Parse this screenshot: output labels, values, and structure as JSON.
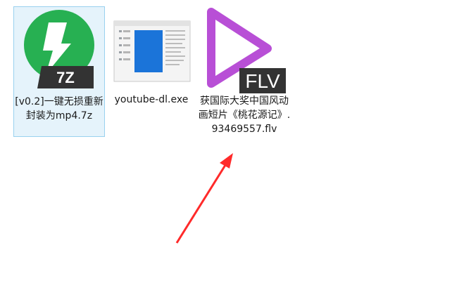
{
  "files": [
    {
      "label": "[v0.2]一键无损重新封装为mp4.7z",
      "badge": "7Z",
      "icon": "7z-archive-icon",
      "selected": true
    },
    {
      "label": "youtube-dl.exe",
      "icon": "exe-application-icon",
      "selected": false
    },
    {
      "label": "获国际大奖中国风动画短片《桃花源记》.93469557.flv",
      "badge": "FLV",
      "icon": "flv-video-icon",
      "selected": false
    }
  ],
  "annotation": {
    "icon": "red-arrow-icon",
    "color": "#ff2a2a"
  },
  "colors": {
    "selection_bg": "#e5f3fb",
    "selection_border": "#99d1ef",
    "archive_green": "#27b052",
    "play_purple": "#b84fd6",
    "badge_dark": "#333333",
    "exe_blue": "#1b74d9"
  }
}
